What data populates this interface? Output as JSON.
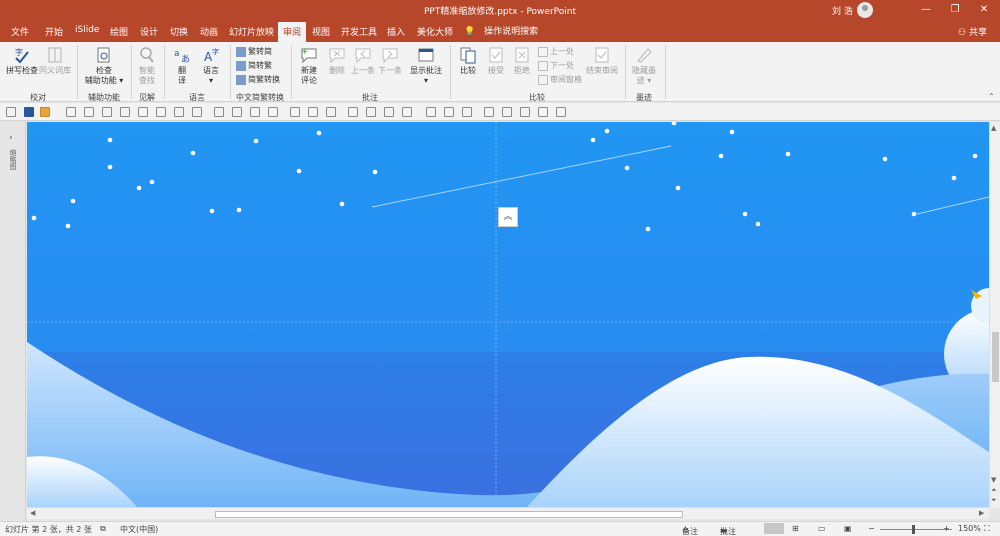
{
  "window": {
    "title": "PPT精准缩放修改.pptx - PowerPoint",
    "user": "刘 浩",
    "controls": [
      "—",
      "❐",
      "✕"
    ]
  },
  "tabs": [
    "文件",
    "开始",
    "iSlide",
    "绘图",
    "设计",
    "切换",
    "动画",
    "幻灯片放映",
    "审阅",
    "视图",
    "开发工具",
    "插入",
    "美化大师"
  ],
  "active_tab": "审阅",
  "tell_me": "操作说明搜索",
  "share": "共享",
  "ribbon": {
    "groups": {
      "proofing": "校对",
      "accessibility": "辅助功能",
      "insights": "见解",
      "language": "语言",
      "cn_conversion": "中文简繁转换",
      "comments": "批注",
      "compare": "比较",
      "ink": "墨迹"
    },
    "buttons": {
      "spellcheck": "拼写检查",
      "thesaurus": "同义词库",
      "check_accessibility_1": "检查",
      "check_accessibility_2": "辅助功能 ▾",
      "smart_lookup_1": "智能",
      "smart_lookup_2": "查找",
      "translate_1": "翻",
      "translate_2": "译",
      "language_1": "语言",
      "language_2": "▾",
      "trad_to_simp": "繁转简",
      "simp_to_trad": "简转繁",
      "convert": "简繁转换",
      "new_comment_1": "新建",
      "new_comment_2": "评论",
      "delete": "删除",
      "previous": "上一条",
      "next": "下一条",
      "show_comments_1": "显示批注",
      "show_comments_2": "▾",
      "compare": "比较",
      "accept": "接受",
      "reject": "拒绝",
      "prev_change": "上一处",
      "next_change": "下一处",
      "reviewing_pane": "审阅窗格",
      "end_review": "结束审阅",
      "hide_ink_1": "隐藏墨",
      "hide_ink_2": "迹 ▾"
    }
  },
  "left_pane": {
    "expand": "›",
    "label": "缩略图"
  },
  "slide": {
    "collapse_glyph": "︽",
    "sky_color": "#2196f3",
    "hill_color": "#ffffff"
  },
  "statusbar": {
    "slide_info": "幻灯片 第 2 张，共 2 张",
    "language": "中文(中国)",
    "notes": "备注",
    "comments": "批注",
    "zoom_minus": "−",
    "zoom_plus": "+",
    "zoom_level": "150%"
  }
}
